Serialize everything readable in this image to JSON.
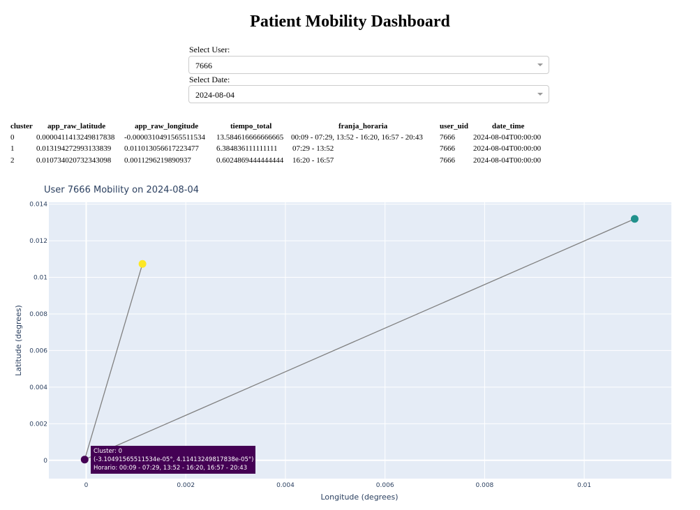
{
  "page": {
    "title": "Patient Mobility Dashboard"
  },
  "controls": {
    "user_label": "Select User:",
    "user_value": "7666",
    "date_label": "Select Date:",
    "date_value": "2024-08-04"
  },
  "table": {
    "headers": [
      "cluster",
      "app_raw_latitude",
      "app_raw_longitude",
      "tiempo_total",
      "franja_horaria",
      "user_uid",
      "date_time"
    ],
    "rows": [
      [
        "0",
        "0.0000411413249817838",
        "-0.0000310491565511534",
        "13.584616666666665",
        "00:09 - 07:29, 13:52 - 16:20, 16:57 - 20:43",
        "7666",
        "2024-08-04T00:00:00"
      ],
      [
        "1",
        "0.013194272993133839",
        "0.011013056617223477",
        "6.384836111111111",
        "07:29 - 13:52",
        "7666",
        "2024-08-04T00:00:00"
      ],
      [
        "2",
        "0.010734020732343098",
        "0.0011296219890937",
        "0.6024869444444444",
        "16:20 - 16:57",
        "7666",
        "2024-08-04T00:00:00"
      ]
    ]
  },
  "chart_data": {
    "type": "scatter",
    "title": "User 7666 Mobility on 2024-08-04",
    "xlabel": "Longitude (degrees)",
    "ylabel": "Latitude (degrees)",
    "xlim": [
      -0.00075,
      0.01175
    ],
    "ylim": [
      -0.001,
      0.0141
    ],
    "x_ticks": [
      0,
      0.002,
      0.004,
      0.006,
      0.008,
      0.01
    ],
    "x_tick_labels": [
      "0",
      "0.002",
      "0.004",
      "0.006",
      "0.008",
      "0.01"
    ],
    "y_ticks": [
      0,
      0.002,
      0.004,
      0.006,
      0.008,
      0.01,
      0.012,
      0.014
    ],
    "y_tick_labels": [
      "0",
      "0.002",
      "0.004",
      "0.006",
      "0.008",
      "0.01",
      "0.012",
      "0.014"
    ],
    "grid": true,
    "points": [
      {
        "cluster": 0,
        "x": -3.10491565511534e-05,
        "y": 4.11413249817838e-05,
        "color": "#440154"
      },
      {
        "cluster": 1,
        "x": 0.011013056617223477,
        "y": 0.013194272993133839,
        "color": "#21918c"
      },
      {
        "cluster": 2,
        "x": 0.0011296219890937,
        "y": 0.010734020732343098,
        "color": "#fde725"
      }
    ],
    "path_order": [
      2,
      0,
      1
    ],
    "line_color": "#808080",
    "plot_bg": "#e5ecf6"
  },
  "hover": {
    "line1": "Cluster: 0",
    "line2": "(-3.10491565511534e-05°, 4.11413249817838e-05°)",
    "line3": "Horario: 00:09 - 07:29, 13:52 - 16:20, 16:57 - 20:43"
  }
}
